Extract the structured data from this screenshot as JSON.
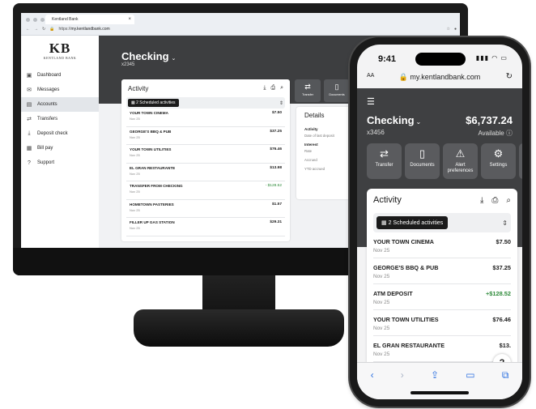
{
  "desktop": {
    "browser": {
      "tab_title": "Kentland Bank",
      "tab_close": "×",
      "url_prefix": "https://",
      "url_host": "my.kentlandbank.com"
    },
    "logo": {
      "mark": "KB",
      "name": "KENTLAND BANK"
    },
    "nav": [
      {
        "label": "Dashboard",
        "icon": "dashboard-icon"
      },
      {
        "label": "Messages",
        "icon": "envelope-icon"
      },
      {
        "label": "Accounts",
        "icon": "accounts-icon",
        "active": true
      },
      {
        "label": "Transfers",
        "icon": "transfer-icon"
      },
      {
        "label": "Deposit check",
        "icon": "deposit-icon"
      },
      {
        "label": "Bill pay",
        "icon": "billpay-icon"
      },
      {
        "label": "Support",
        "icon": "help-icon"
      }
    ],
    "account": {
      "title": "Checking",
      "number": "x2345"
    },
    "activity": {
      "title": "Activity",
      "scheduled": "2 Scheduled activities",
      "transactions": [
        {
          "name": "YOUR TOWN CINEMA",
          "date": "Nov 25",
          "amount": "$7.50"
        },
        {
          "name": "GEORGE'S BBQ & PUB",
          "date": "Nov 25",
          "amount": "$37.25"
        },
        {
          "name": "YOUR TOWN UTILITIES",
          "date": "Nov 25",
          "amount": "$76.46"
        },
        {
          "name": "EL GRAN RESTAURANTE",
          "date": "Nov 25",
          "amount": "$13.98"
        },
        {
          "name": "TRANSFER FROM CHECKING",
          "date": "Nov 25",
          "amount": "- $128.52",
          "positive": true
        },
        {
          "name": "HOMETOWN PASTERIES",
          "date": "Nov 25",
          "amount": "$1.57"
        },
        {
          "name": "FILLER UP GAS STATION",
          "date": "Nov 25",
          "amount": "$29.31"
        }
      ]
    },
    "actions": [
      {
        "label": "Transfer",
        "icon": "transfer-icon"
      },
      {
        "label": "Documents",
        "icon": "document-icon"
      }
    ],
    "details": {
      "title": "Details",
      "activity_heading": "Activity",
      "activity_item": "Date of last deposit",
      "interest_heading": "Interest",
      "interest_items": [
        "Rate",
        "Accrued",
        "YTD accrued"
      ]
    }
  },
  "phone": {
    "status": {
      "time": "9:41",
      "indicators": "▮▮▮ ◠ ▭"
    },
    "browser": {
      "aa": "AA",
      "url": "my.kentlandbank.com",
      "reload": "↻"
    },
    "account": {
      "title": "Checking",
      "number": "x3456",
      "balance": "$6,737.24",
      "balance_label": "Available"
    },
    "actions": [
      {
        "label": "Transfer",
        "icon": "transfer-icon"
      },
      {
        "label": "Documents",
        "icon": "document-icon"
      },
      {
        "label": "Alert preferences",
        "icon": "alert-icon"
      },
      {
        "label": "Settings",
        "icon": "gear-icon"
      }
    ],
    "activity": {
      "title": "Activity",
      "scheduled": "2 Scheduled activities",
      "transactions": [
        {
          "name": "YOUR TOWN CINEMA",
          "date": "Nov 25",
          "amount": "$7.50"
        },
        {
          "name": "GEORGE'S BBQ & PUB",
          "date": "Nov 25",
          "amount": "$37.25"
        },
        {
          "name": "ATM DEPOSIT",
          "date": "Nov 25",
          "amount": "+$128.52",
          "positive": true
        },
        {
          "name": "YOUR TOWN UTILITIES",
          "date": "Nov 25",
          "amount": "$76.46"
        },
        {
          "name": "EL GRAN RESTAURANTE",
          "date": "Nov 25",
          "amount": "$13."
        }
      ]
    },
    "help": "?"
  },
  "colors": {
    "hero": "#3d3e40",
    "action_tile": "#5a5b5e",
    "positive": "#2e8b3a",
    "ios_blue": "#2b6fe0"
  }
}
